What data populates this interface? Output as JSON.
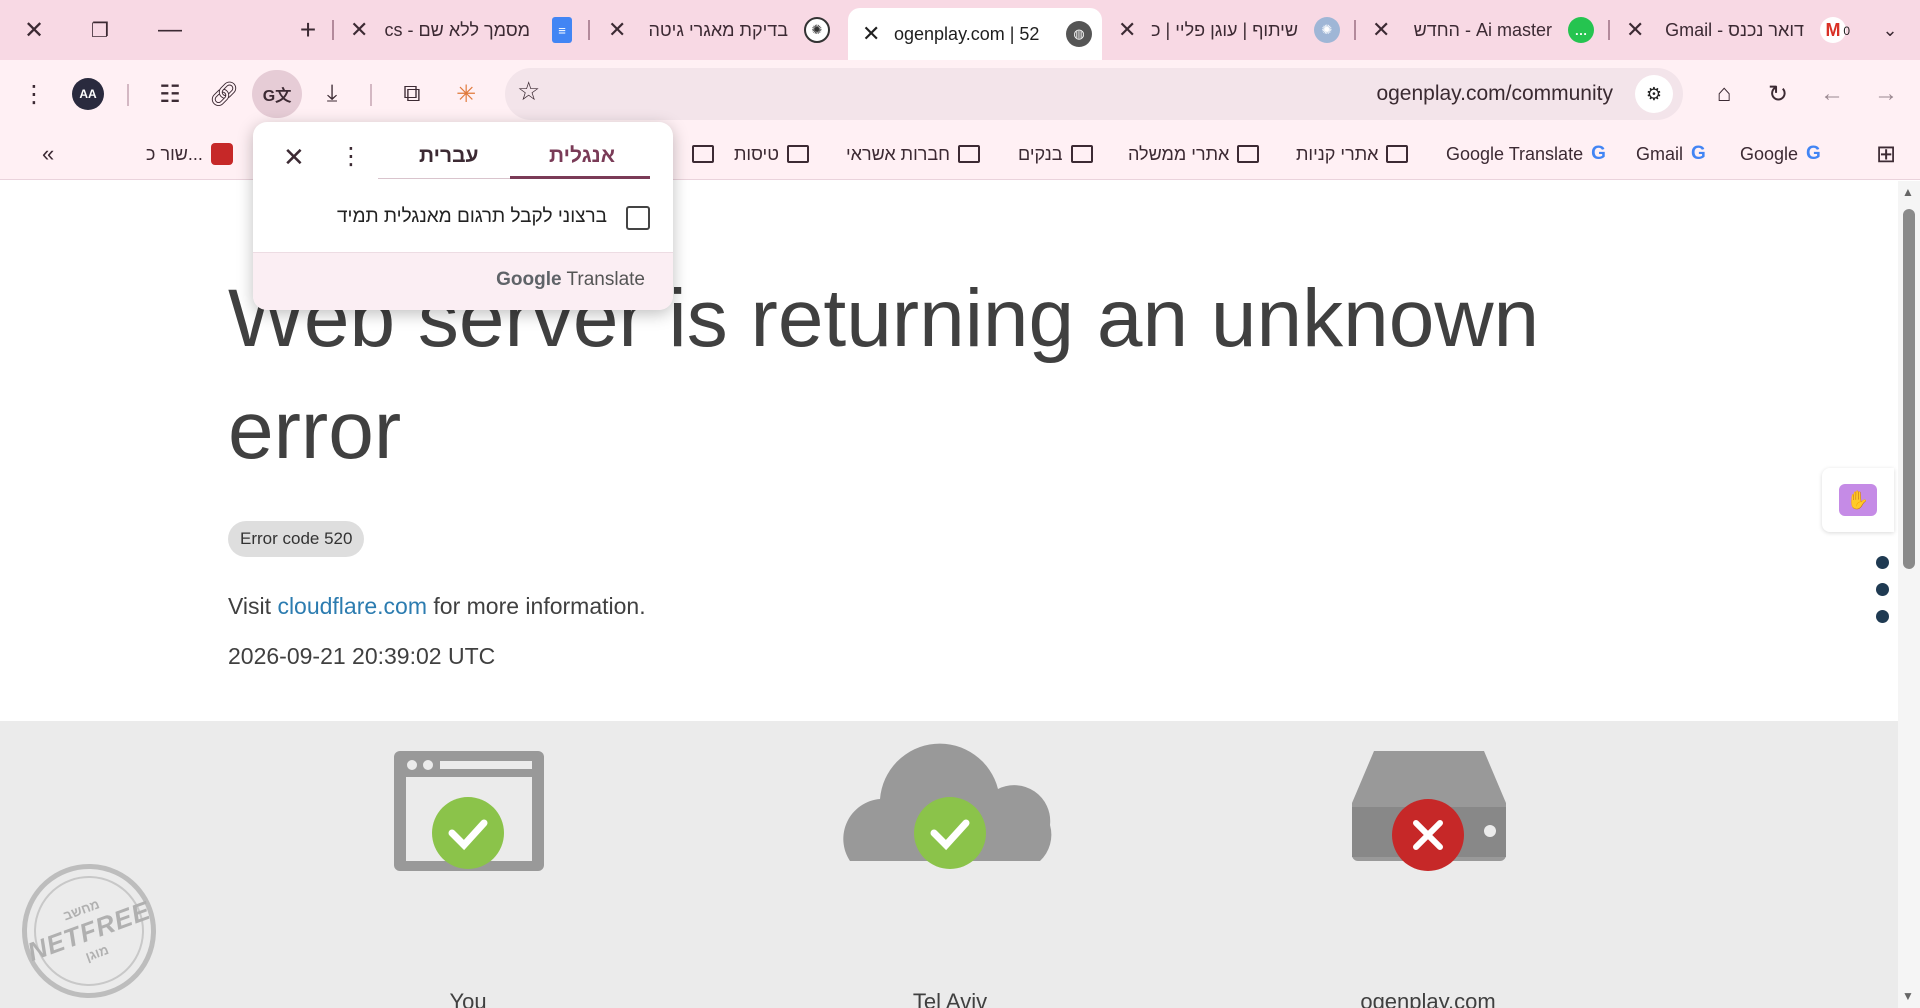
{
  "tabs": [
    {
      "title": "דואר נכנס - Gmail",
      "favicon": "gmail-icon",
      "badge": "0"
    },
    {
      "title": "Ai master - החדש",
      "favicon": "chat-icon"
    },
    {
      "title": "שיתוף | עוגן פליי | כ",
      "favicon": "globe-icon"
    },
    {
      "title": "ogenplay.com | 52",
      "favicon": "globe-icon",
      "active": true
    },
    {
      "title": "בדיקת מאגרי גיטה",
      "favicon": "openai-icon"
    },
    {
      "title": "מסמך ללא שם - cs",
      "favicon": "docs-icon"
    }
  ],
  "toolbar": {
    "url": "ogenplay.com/community",
    "avatar_initials": "AA"
  },
  "bookmarks": [
    {
      "label": "Google",
      "type": "site"
    },
    {
      "label": "Gmail",
      "type": "site"
    },
    {
      "label": "Google Translate",
      "type": "site"
    },
    {
      "label": "אתרי קניות",
      "type": "folder"
    },
    {
      "label": "אתרי ממשלה",
      "type": "folder"
    },
    {
      "label": "בנקים",
      "type": "folder"
    },
    {
      "label": "חברות אשראי",
      "type": "folder"
    },
    {
      "label": "טיסות",
      "type": "folder"
    },
    {
      "label": "...שור כ",
      "type": "site"
    }
  ],
  "translate_popup": {
    "tab_source": "אנגלית",
    "tab_target": "עברית",
    "always_label": "ברצוני לקבל תרגום מאנגלית תמיד",
    "brand_google": "Google",
    "brand_translate": "Translate"
  },
  "page": {
    "title": "Web server is returning an unknown error",
    "error_code": "Error code 520",
    "visit_prefix": "Visit",
    "visit_link": "cloudflare.com",
    "visit_suffix": "for more information.",
    "timestamp": "2026-09-21 20:39:02 UTC",
    "diagram": [
      {
        "label": "You",
        "status": "ok"
      },
      {
        "label": "Tel Aviv",
        "status": "ok"
      },
      {
        "label": "ogenplay.com",
        "status": "error"
      }
    ]
  },
  "watermark": {
    "main": "NETFREE",
    "top": "מחשב",
    "bottom": "מוגן"
  },
  "colors": {
    "ok": "#8bc34a",
    "error": "#c62828",
    "link": "#2c7cb0",
    "tab_strip": "#f8d9e4"
  }
}
